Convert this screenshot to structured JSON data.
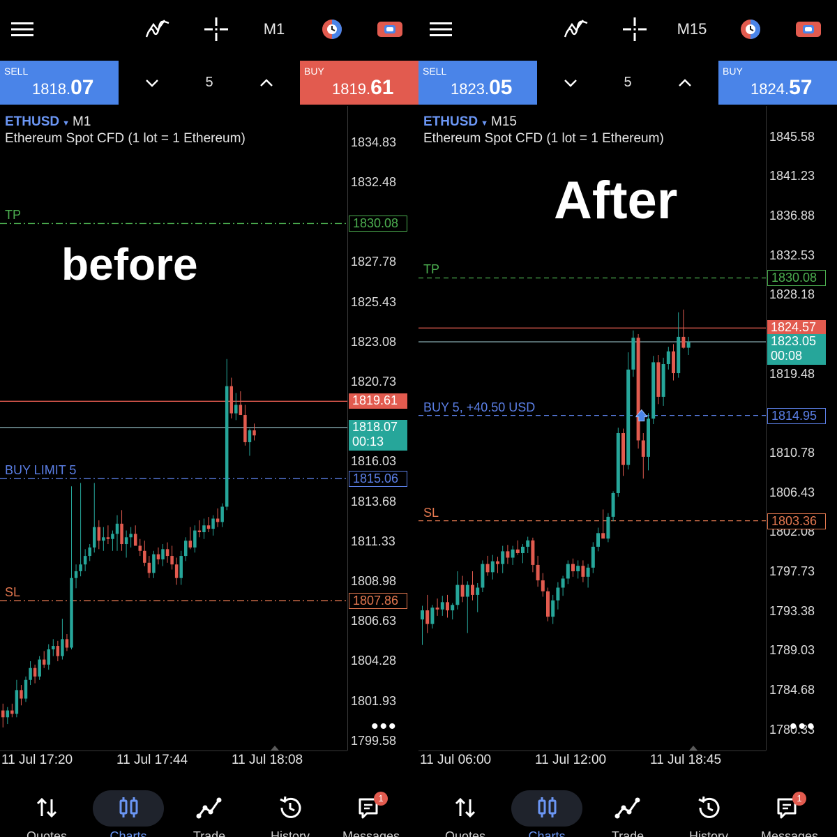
{
  "colors": {
    "background": "#000000",
    "sell": "#4a84e8",
    "buy_left": "#e25b4f",
    "buy_right": "#4a84e8",
    "bull": "#26a69a",
    "bear": "#e25b4f",
    "tp": "#4caf50",
    "sl": "#e2774f",
    "order": "#5b7fe6",
    "bid_line": "#7fa3a8",
    "ask_line": "#e25b4f",
    "accent": "#6b96f4"
  },
  "panels": [
    {
      "toolbar": {
        "menu_icon": "hamburger-menu-icon",
        "indicators_icon": "indicators-icon",
        "crosshair_icon": "crosshair-icon",
        "timeframe": "M1",
        "objects_icon": "objects-icon",
        "trade_icon": "trade-icon"
      },
      "order": {
        "sell_label": "SELL",
        "sell_prefix": "1818.",
        "sell_big": "07",
        "volume": "5",
        "buy_label": "BUY",
        "buy_prefix": "1819.",
        "buy_big": "61"
      },
      "chart": {
        "symbol": "ETHUSD",
        "symbol_caret": "▼",
        "timeframe": "M1",
        "description": "Ethereum Spot CFD (1 lot = 1 Ethereum)",
        "overlay_text": "before",
        "tp_label": "TP",
        "tp_price": "1830.08",
        "sl_label": "SL",
        "sl_price": "1807.86",
        "order_label": "BUY LIMIT 5",
        "order_price": "1815.06",
        "ask_price": "1819.61",
        "bid_price": "1818.07",
        "countdown": "00:13",
        "price_axis": [
          "1834.83",
          "1832.48",
          "1827.78",
          "1825.43",
          "1823.08",
          "1820.73",
          "1816.03",
          "1813.68",
          "1811.33",
          "1808.98",
          "1806.63",
          "1804.28",
          "1801.93",
          "1799.58"
        ],
        "more": "•••",
        "time_axis": [
          "11 Jul 17:20",
          "11 Jul 17:44",
          "11 Jul 18:08"
        ]
      },
      "nav": [
        {
          "label": "Quotes",
          "icon": "quotes-arrows-icon"
        },
        {
          "label": "Charts",
          "icon": "charts-candles-icon"
        },
        {
          "label": "Trade",
          "icon": "trade-line-icon"
        },
        {
          "label": "History",
          "icon": "history-clock-icon"
        },
        {
          "label": "Messages",
          "icon": "messages-icon",
          "badge": "1"
        }
      ]
    },
    {
      "toolbar": {
        "menu_icon": "hamburger-menu-icon",
        "indicators_icon": "indicators-icon",
        "crosshair_icon": "crosshair-icon",
        "timeframe": "M15",
        "objects_icon": "objects-icon",
        "trade_icon": "trade-icon"
      },
      "order": {
        "sell_label": "SELL",
        "sell_prefix": "1823.",
        "sell_big": "05",
        "volume": "5",
        "buy_label": "BUY",
        "buy_prefix": "1824.",
        "buy_big": "57"
      },
      "chart": {
        "symbol": "ETHUSD",
        "symbol_caret": "▼",
        "timeframe": "M15",
        "description": "Ethereum Spot CFD (1 lot = 1 Ethereum)",
        "overlay_text": "After",
        "tp_label": "TP",
        "tp_price": "1830.08",
        "sl_label": "SL",
        "sl_price": "1803.36",
        "order_label": "BUY 5,  +40.50 USD",
        "order_price": "1814.95",
        "ask_price": "1824.57",
        "bid_price": "1823.05",
        "countdown": "00:08",
        "price_axis": [
          "1845.58",
          "1841.23",
          "1836.88",
          "1832.53",
          "1828.18",
          "1819.48",
          "1810.78",
          "1806.43",
          "1802.08",
          "1797.73",
          "1793.38",
          "1789.03",
          "1784.68",
          "1780.33"
        ],
        "more": "•••",
        "time_axis": [
          "11 Jul 06:00",
          "11 Jul 12:00",
          "11 Jul 18:45"
        ]
      },
      "nav": [
        {
          "label": "Quotes",
          "icon": "quotes-arrows-icon"
        },
        {
          "label": "Charts",
          "icon": "charts-candles-icon"
        },
        {
          "label": "Trade",
          "icon": "trade-line-icon"
        },
        {
          "label": "History",
          "icon": "history-clock-icon"
        },
        {
          "label": "Messages",
          "icon": "messages-icon",
          "badge": "1"
        }
      ]
    }
  ],
  "chart_data": [
    {
      "type": "candlestick",
      "symbol": "ETHUSD",
      "timeframe": "M1",
      "ylim": [
        1799.0,
        1837.0
      ],
      "x_ticks": [
        "11 Jul 17:20",
        "11 Jul 17:44",
        "11 Jul 18:08"
      ],
      "candles": [
        [
          1801.4,
          1801.8,
          1800.4,
          1801.0
        ],
        [
          1801.0,
          1801.6,
          1800.6,
          1801.4
        ],
        [
          1801.4,
          1801.8,
          1801.0,
          1801.2
        ],
        [
          1801.2,
          1803.2,
          1801.0,
          1802.6
        ],
        [
          1802.6,
          1802.9,
          1801.7,
          1802.1
        ],
        [
          1802.1,
          1803.4,
          1801.9,
          1803.2
        ],
        [
          1803.2,
          1804.3,
          1802.9,
          1803.9
        ],
        [
          1803.9,
          1804.1,
          1803.0,
          1803.4
        ],
        [
          1803.4,
          1804.6,
          1803.2,
          1804.4
        ],
        [
          1804.4,
          1804.9,
          1803.9,
          1804.1
        ],
        [
          1804.1,
          1805.3,
          1803.8,
          1805.0
        ],
        [
          1805.0,
          1805.6,
          1804.6,
          1805.2
        ],
        [
          1805.2,
          1805.5,
          1804.3,
          1804.6
        ],
        [
          1804.6,
          1806.8,
          1804.4,
          1805.6
        ],
        [
          1805.6,
          1805.9,
          1804.9,
          1805.1
        ],
        [
          1805.1,
          1814.6,
          1805.0,
          1809.2
        ],
        [
          1809.2,
          1810.0,
          1808.6,
          1809.6
        ],
        [
          1809.6,
          1814.8,
          1809.3,
          1810.0
        ],
        [
          1810.0,
          1810.9,
          1809.6,
          1810.5
        ],
        [
          1810.5,
          1811.2,
          1810.2,
          1811.0
        ],
        [
          1811.0,
          1814.8,
          1810.7,
          1812.2
        ],
        [
          1812.2,
          1812.6,
          1810.9,
          1811.4
        ],
        [
          1811.4,
          1812.2,
          1810.8,
          1811.6
        ],
        [
          1811.6,
          1812.3,
          1811.2,
          1811.5
        ],
        [
          1811.5,
          1812.0,
          1810.8,
          1811.8
        ],
        [
          1811.8,
          1812.9,
          1810.8,
          1812.4
        ],
        [
          1812.4,
          1813.2,
          1810.8,
          1811.2
        ],
        [
          1811.2,
          1812.0,
          1810.4,
          1811.6
        ],
        [
          1811.6,
          1812.2,
          1811.0,
          1811.8
        ],
        [
          1811.8,
          1812.3,
          1811.4,
          1811.1
        ],
        [
          1811.1,
          1811.5,
          1810.5,
          1810.8
        ],
        [
          1810.8,
          1811.4,
          1809.9,
          1810.1
        ],
        [
          1810.1,
          1810.5,
          1809.2,
          1809.5
        ],
        [
          1809.5,
          1810.8,
          1809.2,
          1810.6
        ],
        [
          1810.6,
          1811.0,
          1810.0,
          1810.3
        ],
        [
          1810.3,
          1811.2,
          1809.9,
          1810.9
        ],
        [
          1810.9,
          1811.3,
          1810.1,
          1810.5
        ],
        [
          1810.5,
          1811.1,
          1809.7,
          1810.0
        ],
        [
          1810.0,
          1810.4,
          1808.8,
          1809.2
        ],
        [
          1809.2,
          1810.8,
          1808.8,
          1810.5
        ],
        [
          1810.5,
          1811.6,
          1810.2,
          1811.4
        ],
        [
          1811.4,
          1812.2,
          1810.9,
          1811.0
        ],
        [
          1811.0,
          1812.3,
          1810.7,
          1812.0
        ],
        [
          1812.0,
          1812.6,
          1811.6,
          1811.9
        ],
        [
          1811.9,
          1812.7,
          1811.5,
          1812.3
        ],
        [
          1812.3,
          1812.8,
          1811.9,
          1812.1
        ],
        [
          1812.1,
          1812.9,
          1811.7,
          1812.7
        ],
        [
          1812.7,
          1813.3,
          1812.2,
          1812.5
        ],
        [
          1812.5,
          1813.6,
          1812.2,
          1813.4
        ],
        [
          1813.4,
          1822.1,
          1813.2,
          1820.5
        ],
        [
          1820.5,
          1821.0,
          1818.6,
          1818.9
        ],
        [
          1818.9,
          1820.1,
          1818.5,
          1819.4
        ],
        [
          1819.4,
          1820.2,
          1818.8,
          1818.8
        ],
        [
          1818.8,
          1819.4,
          1817.0,
          1817.2
        ],
        [
          1817.2,
          1818.0,
          1816.4,
          1817.9
        ],
        [
          1817.9,
          1818.3,
          1817.3,
          1817.6
        ]
      ],
      "lines": {
        "tp": 1830.08,
        "sl": 1807.86,
        "buy_limit": 1815.06,
        "ask": 1819.61,
        "bid": 1818.07
      }
    },
    {
      "type": "candlestick",
      "symbol": "ETHUSD",
      "timeframe": "M15",
      "ylim": [
        1778.0,
        1849.0
      ],
      "x_ticks": [
        "11 Jul 06:00",
        "11 Jul 12:00",
        "11 Jul 18:45"
      ],
      "candles": [
        [
          1792.5,
          1794.0,
          1789.7,
          1793.5
        ],
        [
          1793.5,
          1795.2,
          1791.0,
          1792.0
        ],
        [
          1792.0,
          1794.1,
          1791.5,
          1793.8
        ],
        [
          1793.8,
          1794.8,
          1792.9,
          1793.6
        ],
        [
          1793.6,
          1795.1,
          1792.9,
          1794.4
        ],
        [
          1794.4,
          1795.2,
          1792.7,
          1793.5
        ],
        [
          1793.5,
          1794.3,
          1792.5,
          1794.1
        ],
        [
          1794.1,
          1797.8,
          1793.6,
          1796.3
        ],
        [
          1796.3,
          1797.3,
          1794.4,
          1795.0
        ],
        [
          1795.0,
          1796.7,
          1791.0,
          1796.3
        ],
        [
          1796.3,
          1797.8,
          1794.6,
          1795.2
        ],
        [
          1795.2,
          1796.5,
          1793.3,
          1796.0
        ],
        [
          1796.0,
          1799.0,
          1795.5,
          1798.6
        ],
        [
          1798.6,
          1799.5,
          1797.3,
          1797.7
        ],
        [
          1797.7,
          1799.6,
          1796.9,
          1798.9
        ],
        [
          1798.9,
          1799.4,
          1797.6,
          1798.6
        ],
        [
          1798.6,
          1800.6,
          1797.6,
          1800.0
        ],
        [
          1800.0,
          1800.7,
          1798.6,
          1799.3
        ],
        [
          1799.3,
          1800.6,
          1798.5,
          1800.2
        ],
        [
          1800.2,
          1801.2,
          1799.6,
          1799.8
        ],
        [
          1799.8,
          1800.8,
          1798.7,
          1800.5
        ],
        [
          1800.5,
          1801.6,
          1799.8,
          1801.2
        ],
        [
          1801.2,
          1801.5,
          1797.7,
          1798.5
        ],
        [
          1798.5,
          1799.5,
          1796.1,
          1796.8
        ],
        [
          1796.8,
          1797.6,
          1795.0,
          1795.6
        ],
        [
          1795.6,
          1796.0,
          1792.3,
          1792.8
        ],
        [
          1792.8,
          1795.2,
          1792.0,
          1794.6
        ],
        [
          1794.6,
          1796.6,
          1793.6,
          1796.0
        ],
        [
          1796.0,
          1797.3,
          1795.1,
          1797.0
        ],
        [
          1797.0,
          1799.0,
          1796.4,
          1798.6
        ],
        [
          1798.6,
          1799.2,
          1797.2,
          1797.8
        ],
        [
          1797.8,
          1799.0,
          1797.0,
          1798.4
        ],
        [
          1798.4,
          1799.0,
          1796.6,
          1797.2
        ],
        [
          1797.2,
          1798.6,
          1796.0,
          1798.2
        ],
        [
          1798.2,
          1801.0,
          1797.6,
          1800.5
        ],
        [
          1800.5,
          1802.6,
          1800.0,
          1802.0
        ],
        [
          1802.0,
          1804.6,
          1801.4,
          1801.4
        ],
        [
          1801.4,
          1804.2,
          1801.0,
          1803.8
        ],
        [
          1803.8,
          1806.6,
          1803.3,
          1806.4
        ],
        [
          1806.4,
          1813.6,
          1806.0,
          1813.0
        ],
        [
          1813.0,
          1813.5,
          1808.3,
          1809.5
        ],
        [
          1809.5,
          1821.9,
          1809.0,
          1820.0
        ],
        [
          1820.0,
          1824.3,
          1819.2,
          1823.5
        ],
        [
          1823.5,
          1823.9,
          1811.3,
          1812.2
        ],
        [
          1812.2,
          1813.0,
          1808.0,
          1810.4
        ],
        [
          1810.4,
          1815.2,
          1808.9,
          1814.6
        ],
        [
          1814.6,
          1821.5,
          1814.0,
          1820.8
        ],
        [
          1820.8,
          1821.6,
          1816.2,
          1817.0
        ],
        [
          1817.0,
          1821.3,
          1816.0,
          1820.6
        ],
        [
          1820.6,
          1822.5,
          1820.0,
          1822.0
        ],
        [
          1822.0,
          1822.8,
          1818.8,
          1819.6
        ],
        [
          1819.6,
          1826.3,
          1819.1,
          1823.6
        ],
        [
          1823.6,
          1826.6,
          1822.3,
          1822.4
        ],
        [
          1822.4,
          1823.6,
          1821.6,
          1823.0
        ]
      ],
      "lines": {
        "tp": 1830.08,
        "sl": 1803.36,
        "position": 1814.95,
        "ask": 1824.57,
        "bid": 1823.05
      }
    }
  ]
}
